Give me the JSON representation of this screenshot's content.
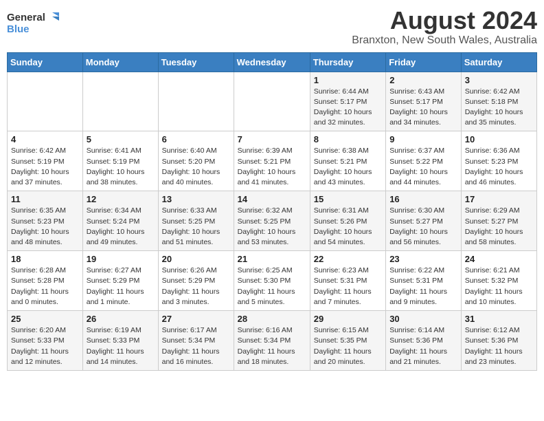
{
  "logo": {
    "line1": "General",
    "line2": "Blue"
  },
  "title": "August 2024",
  "subtitle": "Branxton, New South Wales, Australia",
  "days_of_week": [
    "Sunday",
    "Monday",
    "Tuesday",
    "Wednesday",
    "Thursday",
    "Friday",
    "Saturday"
  ],
  "weeks": [
    [
      {
        "num": "",
        "info": ""
      },
      {
        "num": "",
        "info": ""
      },
      {
        "num": "",
        "info": ""
      },
      {
        "num": "",
        "info": ""
      },
      {
        "num": "1",
        "info": "Sunrise: 6:44 AM\nSunset: 5:17 PM\nDaylight: 10 hours\nand 32 minutes."
      },
      {
        "num": "2",
        "info": "Sunrise: 6:43 AM\nSunset: 5:17 PM\nDaylight: 10 hours\nand 34 minutes."
      },
      {
        "num": "3",
        "info": "Sunrise: 6:42 AM\nSunset: 5:18 PM\nDaylight: 10 hours\nand 35 minutes."
      }
    ],
    [
      {
        "num": "4",
        "info": "Sunrise: 6:42 AM\nSunset: 5:19 PM\nDaylight: 10 hours\nand 37 minutes."
      },
      {
        "num": "5",
        "info": "Sunrise: 6:41 AM\nSunset: 5:19 PM\nDaylight: 10 hours\nand 38 minutes."
      },
      {
        "num": "6",
        "info": "Sunrise: 6:40 AM\nSunset: 5:20 PM\nDaylight: 10 hours\nand 40 minutes."
      },
      {
        "num": "7",
        "info": "Sunrise: 6:39 AM\nSunset: 5:21 PM\nDaylight: 10 hours\nand 41 minutes."
      },
      {
        "num": "8",
        "info": "Sunrise: 6:38 AM\nSunset: 5:21 PM\nDaylight: 10 hours\nand 43 minutes."
      },
      {
        "num": "9",
        "info": "Sunrise: 6:37 AM\nSunset: 5:22 PM\nDaylight: 10 hours\nand 44 minutes."
      },
      {
        "num": "10",
        "info": "Sunrise: 6:36 AM\nSunset: 5:23 PM\nDaylight: 10 hours\nand 46 minutes."
      }
    ],
    [
      {
        "num": "11",
        "info": "Sunrise: 6:35 AM\nSunset: 5:23 PM\nDaylight: 10 hours\nand 48 minutes."
      },
      {
        "num": "12",
        "info": "Sunrise: 6:34 AM\nSunset: 5:24 PM\nDaylight: 10 hours\nand 49 minutes."
      },
      {
        "num": "13",
        "info": "Sunrise: 6:33 AM\nSunset: 5:25 PM\nDaylight: 10 hours\nand 51 minutes."
      },
      {
        "num": "14",
        "info": "Sunrise: 6:32 AM\nSunset: 5:25 PM\nDaylight: 10 hours\nand 53 minutes."
      },
      {
        "num": "15",
        "info": "Sunrise: 6:31 AM\nSunset: 5:26 PM\nDaylight: 10 hours\nand 54 minutes."
      },
      {
        "num": "16",
        "info": "Sunrise: 6:30 AM\nSunset: 5:27 PM\nDaylight: 10 hours\nand 56 minutes."
      },
      {
        "num": "17",
        "info": "Sunrise: 6:29 AM\nSunset: 5:27 PM\nDaylight: 10 hours\nand 58 minutes."
      }
    ],
    [
      {
        "num": "18",
        "info": "Sunrise: 6:28 AM\nSunset: 5:28 PM\nDaylight: 11 hours\nand 0 minutes."
      },
      {
        "num": "19",
        "info": "Sunrise: 6:27 AM\nSunset: 5:29 PM\nDaylight: 11 hours\nand 1 minute."
      },
      {
        "num": "20",
        "info": "Sunrise: 6:26 AM\nSunset: 5:29 PM\nDaylight: 11 hours\nand 3 minutes."
      },
      {
        "num": "21",
        "info": "Sunrise: 6:25 AM\nSunset: 5:30 PM\nDaylight: 11 hours\nand 5 minutes."
      },
      {
        "num": "22",
        "info": "Sunrise: 6:23 AM\nSunset: 5:31 PM\nDaylight: 11 hours\nand 7 minutes."
      },
      {
        "num": "23",
        "info": "Sunrise: 6:22 AM\nSunset: 5:31 PM\nDaylight: 11 hours\nand 9 minutes."
      },
      {
        "num": "24",
        "info": "Sunrise: 6:21 AM\nSunset: 5:32 PM\nDaylight: 11 hours\nand 10 minutes."
      }
    ],
    [
      {
        "num": "25",
        "info": "Sunrise: 6:20 AM\nSunset: 5:33 PM\nDaylight: 11 hours\nand 12 minutes."
      },
      {
        "num": "26",
        "info": "Sunrise: 6:19 AM\nSunset: 5:33 PM\nDaylight: 11 hours\nand 14 minutes."
      },
      {
        "num": "27",
        "info": "Sunrise: 6:17 AM\nSunset: 5:34 PM\nDaylight: 11 hours\nand 16 minutes."
      },
      {
        "num": "28",
        "info": "Sunrise: 6:16 AM\nSunset: 5:34 PM\nDaylight: 11 hours\nand 18 minutes."
      },
      {
        "num": "29",
        "info": "Sunrise: 6:15 AM\nSunset: 5:35 PM\nDaylight: 11 hours\nand 20 minutes."
      },
      {
        "num": "30",
        "info": "Sunrise: 6:14 AM\nSunset: 5:36 PM\nDaylight: 11 hours\nand 21 minutes."
      },
      {
        "num": "31",
        "info": "Sunrise: 6:12 AM\nSunset: 5:36 PM\nDaylight: 11 hours\nand 23 minutes."
      }
    ]
  ]
}
